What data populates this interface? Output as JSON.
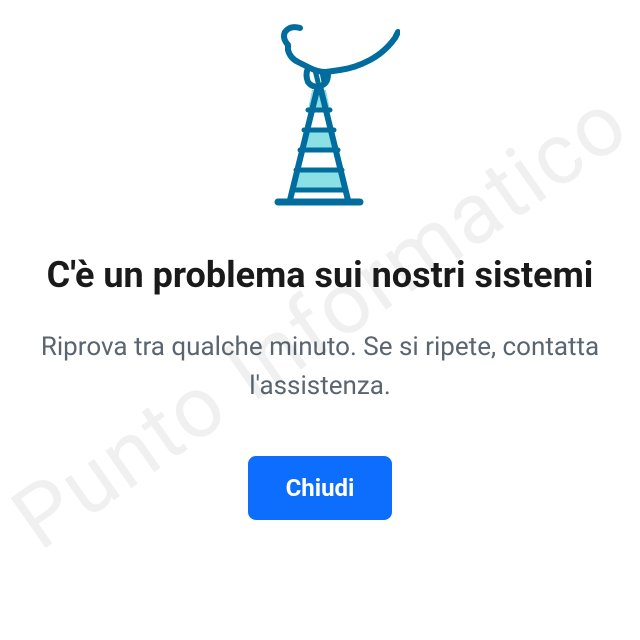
{
  "error_dialog": {
    "title": "C'è un problema sui nostri sistemi",
    "subtitle": "Riprova tra qualche minuto. Se si ripete, contatta l'assistenza.",
    "close_label": "Chiudi"
  },
  "watermark": {
    "text": "Punto Informatico"
  },
  "icon": {
    "name": "hand-cone-icon"
  },
  "colors": {
    "primary_button": "#0d6efd",
    "icon_stroke": "#006d9e",
    "icon_fill": "#8be0e5",
    "text_primary": "#1a1a1a",
    "text_secondary": "#5a6570"
  }
}
